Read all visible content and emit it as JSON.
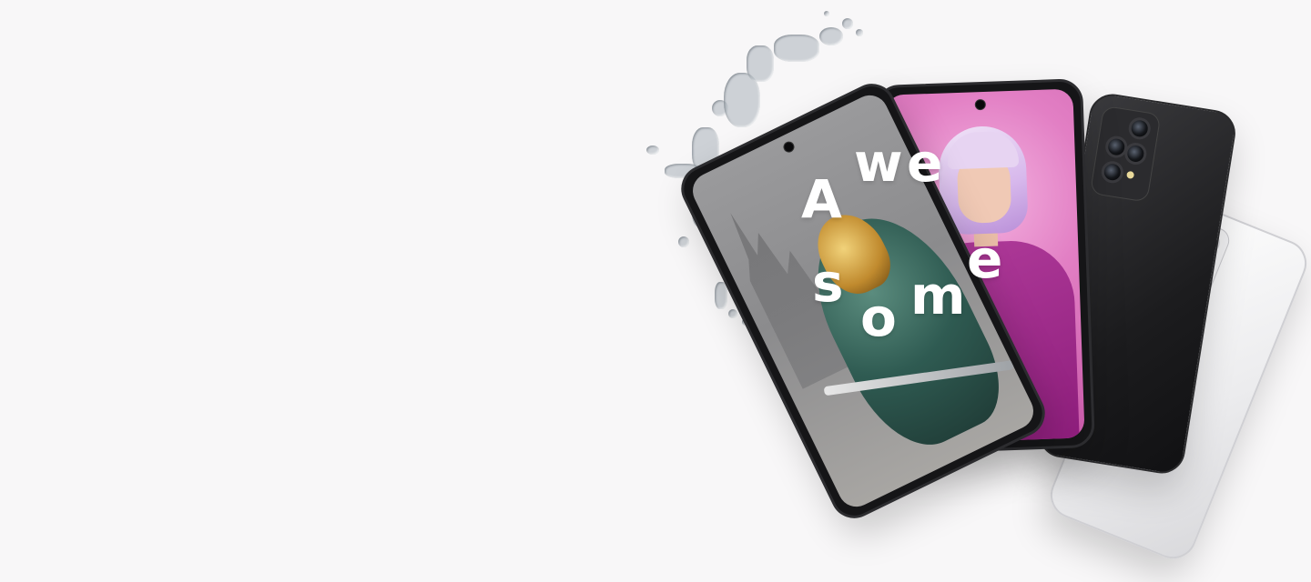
{
  "hero": {
    "headline_letters": [
      "A",
      "w",
      "e",
      "s",
      "o",
      "m",
      "e"
    ]
  },
  "colors": {
    "background": "#f8f7f8",
    "accent_pink": "#e27fc4",
    "sweater_purple": "#9c2a87",
    "phone_black": "#1c1c1e",
    "phone_white": "#ececee"
  }
}
